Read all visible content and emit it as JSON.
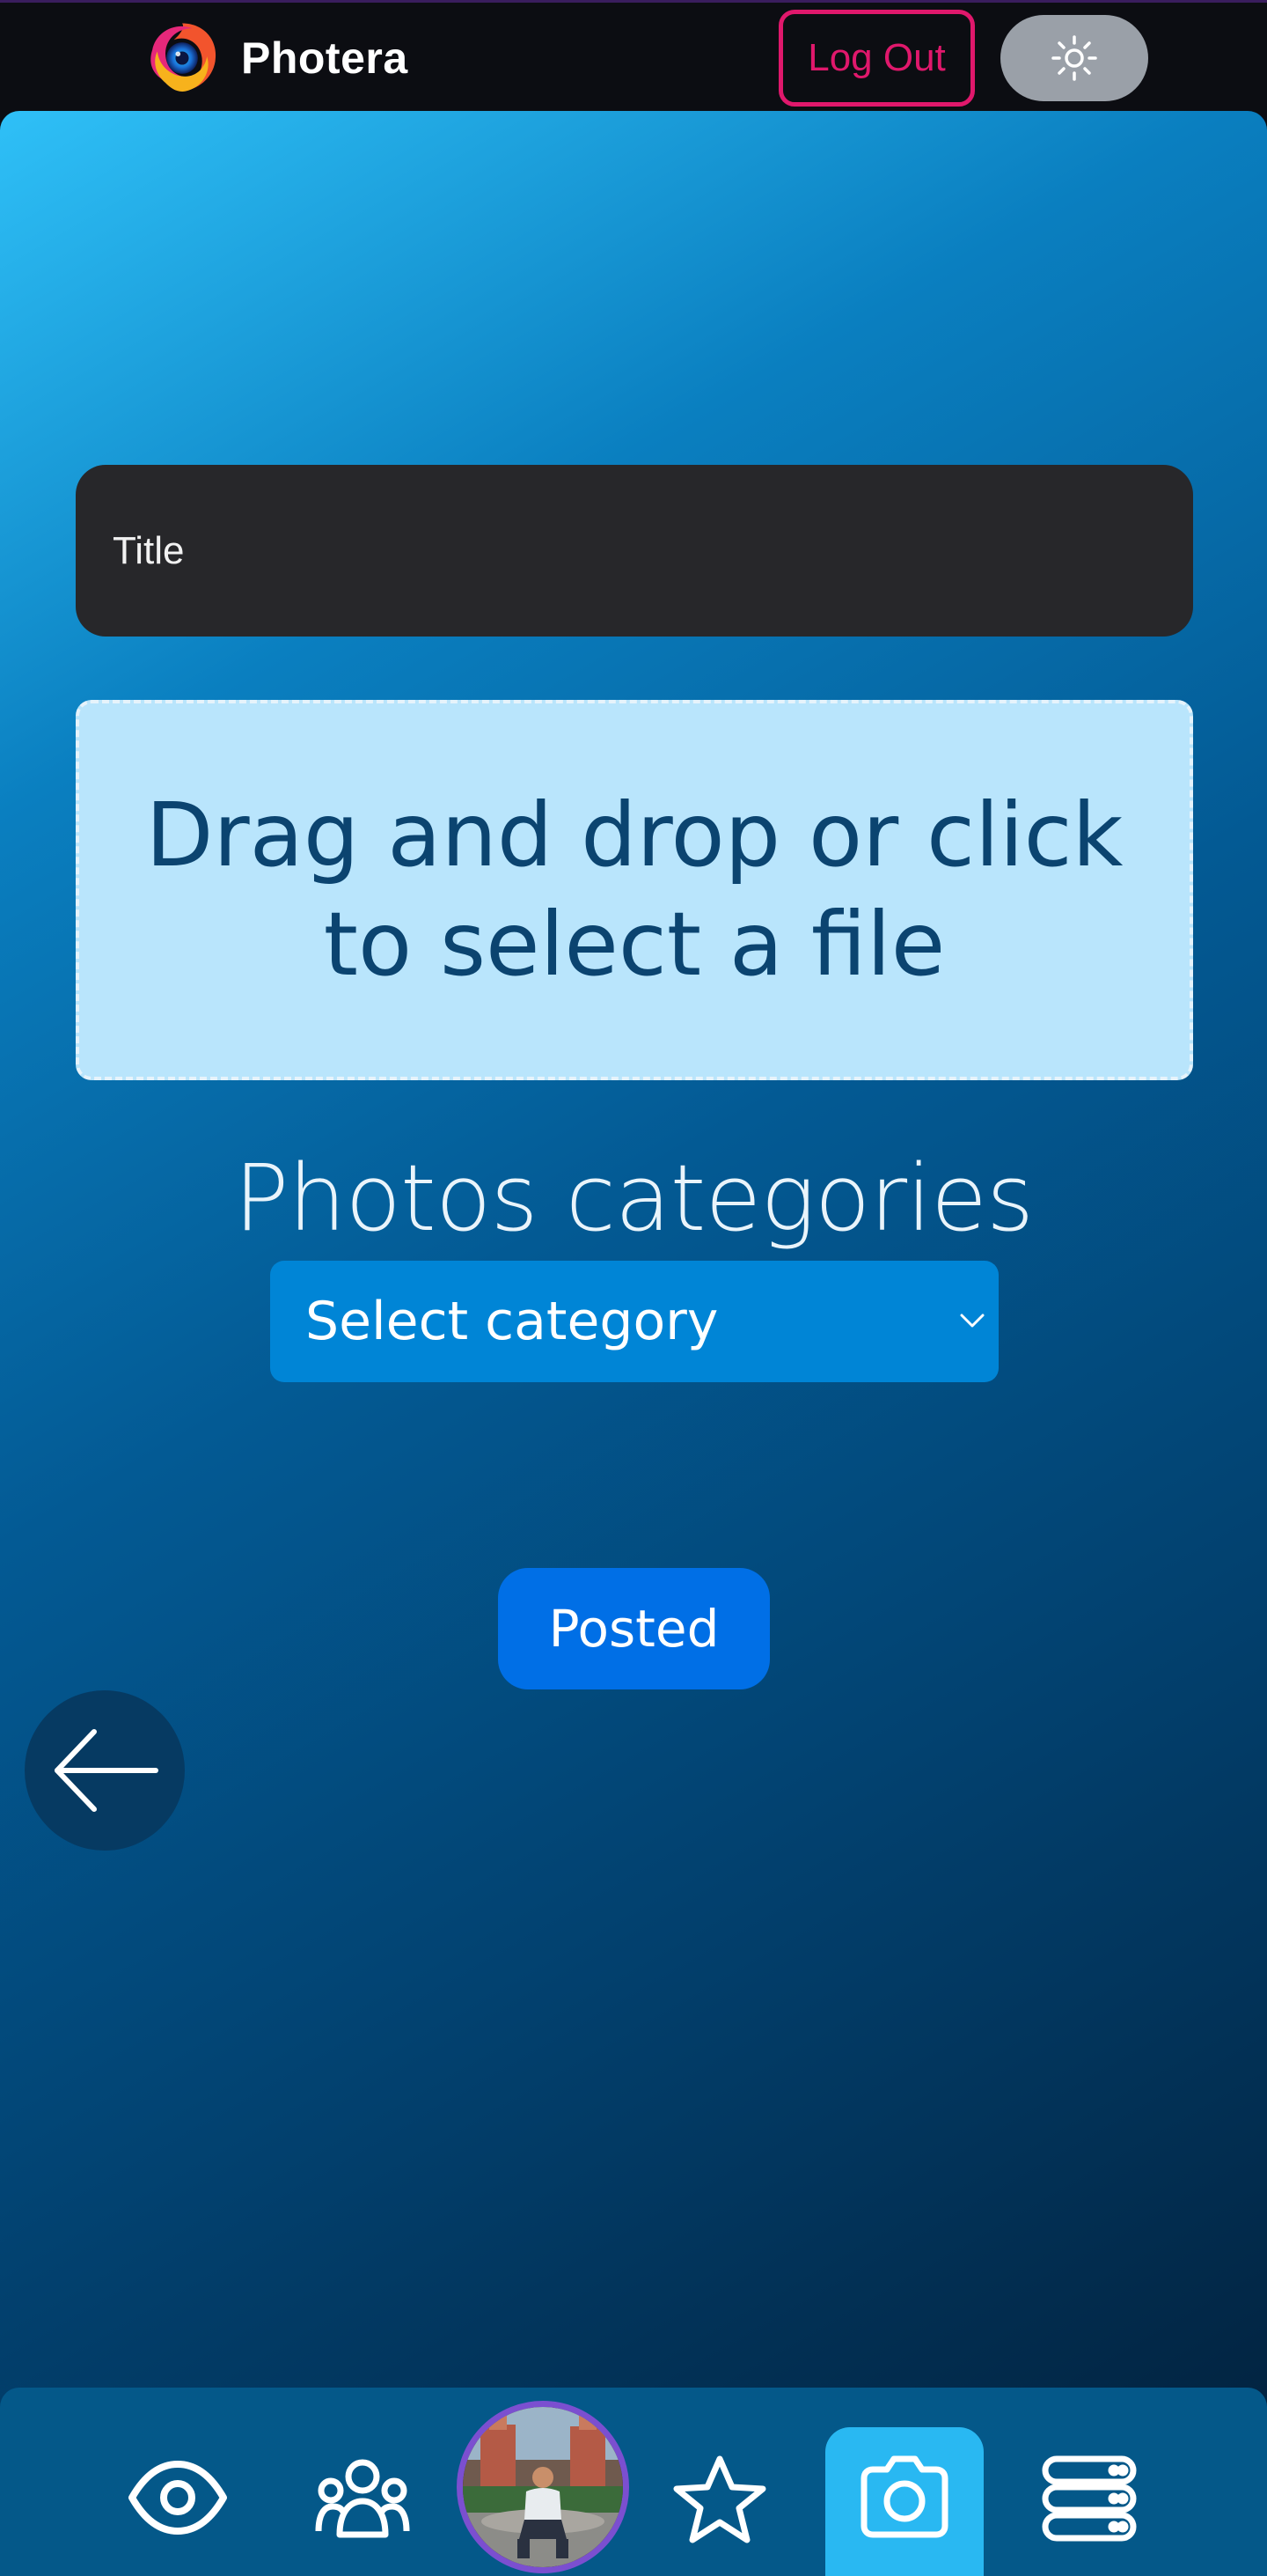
{
  "app": {
    "name": "Photera"
  },
  "header": {
    "logout_label": "Log Out",
    "theme_toggle_icon": "sun-icon"
  },
  "form": {
    "title_placeholder": "Title",
    "dropzone_text": "Drag and drop or click to select a file",
    "categories_heading": "Photos categories",
    "category_select_value": "Select category",
    "submit_label": "Posted"
  },
  "bottom_nav": {
    "items": [
      {
        "icon": "eye-icon",
        "active": false
      },
      {
        "icon": "users-icon",
        "active": false
      },
      {
        "icon": "avatar",
        "active": false
      },
      {
        "icon": "star-icon",
        "active": false
      },
      {
        "icon": "camera-icon",
        "active": true
      },
      {
        "icon": "server-icon",
        "active": false
      }
    ]
  },
  "colors": {
    "accent_pink": "#e0186c",
    "primary_blue": "#006fe6",
    "active_tab": "#29b8f2",
    "avatar_ring": "#7b4fd0"
  }
}
